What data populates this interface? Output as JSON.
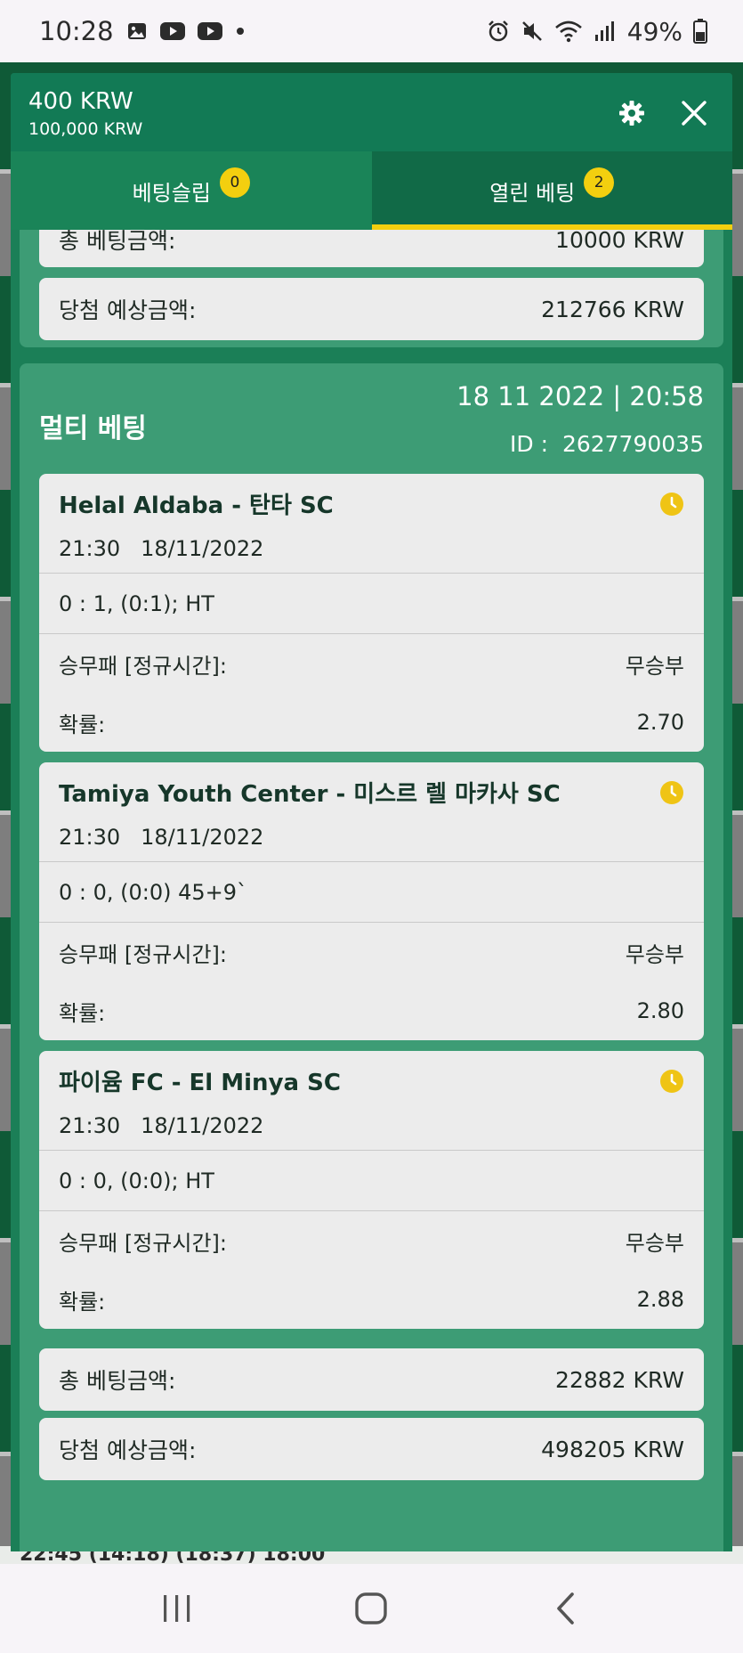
{
  "status_bar": {
    "time": "10:28",
    "battery": "49%",
    "left_icons": [
      "gallery-icon",
      "youtube-icon",
      "youtube-icon",
      "dot-icon"
    ],
    "right_icons": [
      "alarm-icon",
      "mute-icon",
      "wifi-icon",
      "signal-icon",
      "battery-icon"
    ]
  },
  "header": {
    "balance": "400 KRW",
    "sub_balance": "100,000 KRW"
  },
  "tabs": [
    {
      "label": "베팅슬립",
      "badge": "0"
    },
    {
      "label": "열린 베팅",
      "badge": "2"
    }
  ],
  "prev_bet": {
    "total_label": "총 베팅금액:",
    "total_value": "10000 KRW",
    "win_label": "당첨 예상금액:",
    "win_value": "212766 KRW"
  },
  "multi_bet": {
    "title": "멀티 베팅",
    "datetime": "18 11 2022 | 20:58",
    "id_label": "ID :",
    "id_value": "2627790035",
    "events": [
      {
        "name": "Helal Aldaba - 탄타 SC",
        "time": "21:30",
        "date": "18/11/2022",
        "score": "0 : 1, (0:1); HT",
        "market_label": "승무패 [정규시간]:",
        "market_value": "무승부",
        "odds_label": "확률:",
        "odds_value": "2.70"
      },
      {
        "name": "Tamiya Youth Center - 미스르 렐 마카사 SC",
        "time": "21:30",
        "date": "18/11/2022",
        "score": "0 : 0, (0:0) 45+9`",
        "market_label": "승무패 [정규시간]:",
        "market_value": "무승부",
        "odds_label": "확률:",
        "odds_value": "2.80"
      },
      {
        "name": "파이윰 FC - El Minya SC",
        "time": "21:30",
        "date": "18/11/2022",
        "score": "0 : 0, (0:0); HT",
        "market_label": "승무패 [정규시간]:",
        "market_value": "무승부",
        "odds_label": "확률:",
        "odds_value": "2.88"
      }
    ],
    "total_label": "총 베팅금액:",
    "total_value": "22882 KRW",
    "win_label": "당첨 예상금액:",
    "win_value": "498205 KRW"
  },
  "background_peek": "22:45 (14:18) (18:37) 18:00",
  "colors": {
    "header_green": "#127a55",
    "card_green": "#3d9c75",
    "accent_yellow": "#f3cf0f"
  }
}
